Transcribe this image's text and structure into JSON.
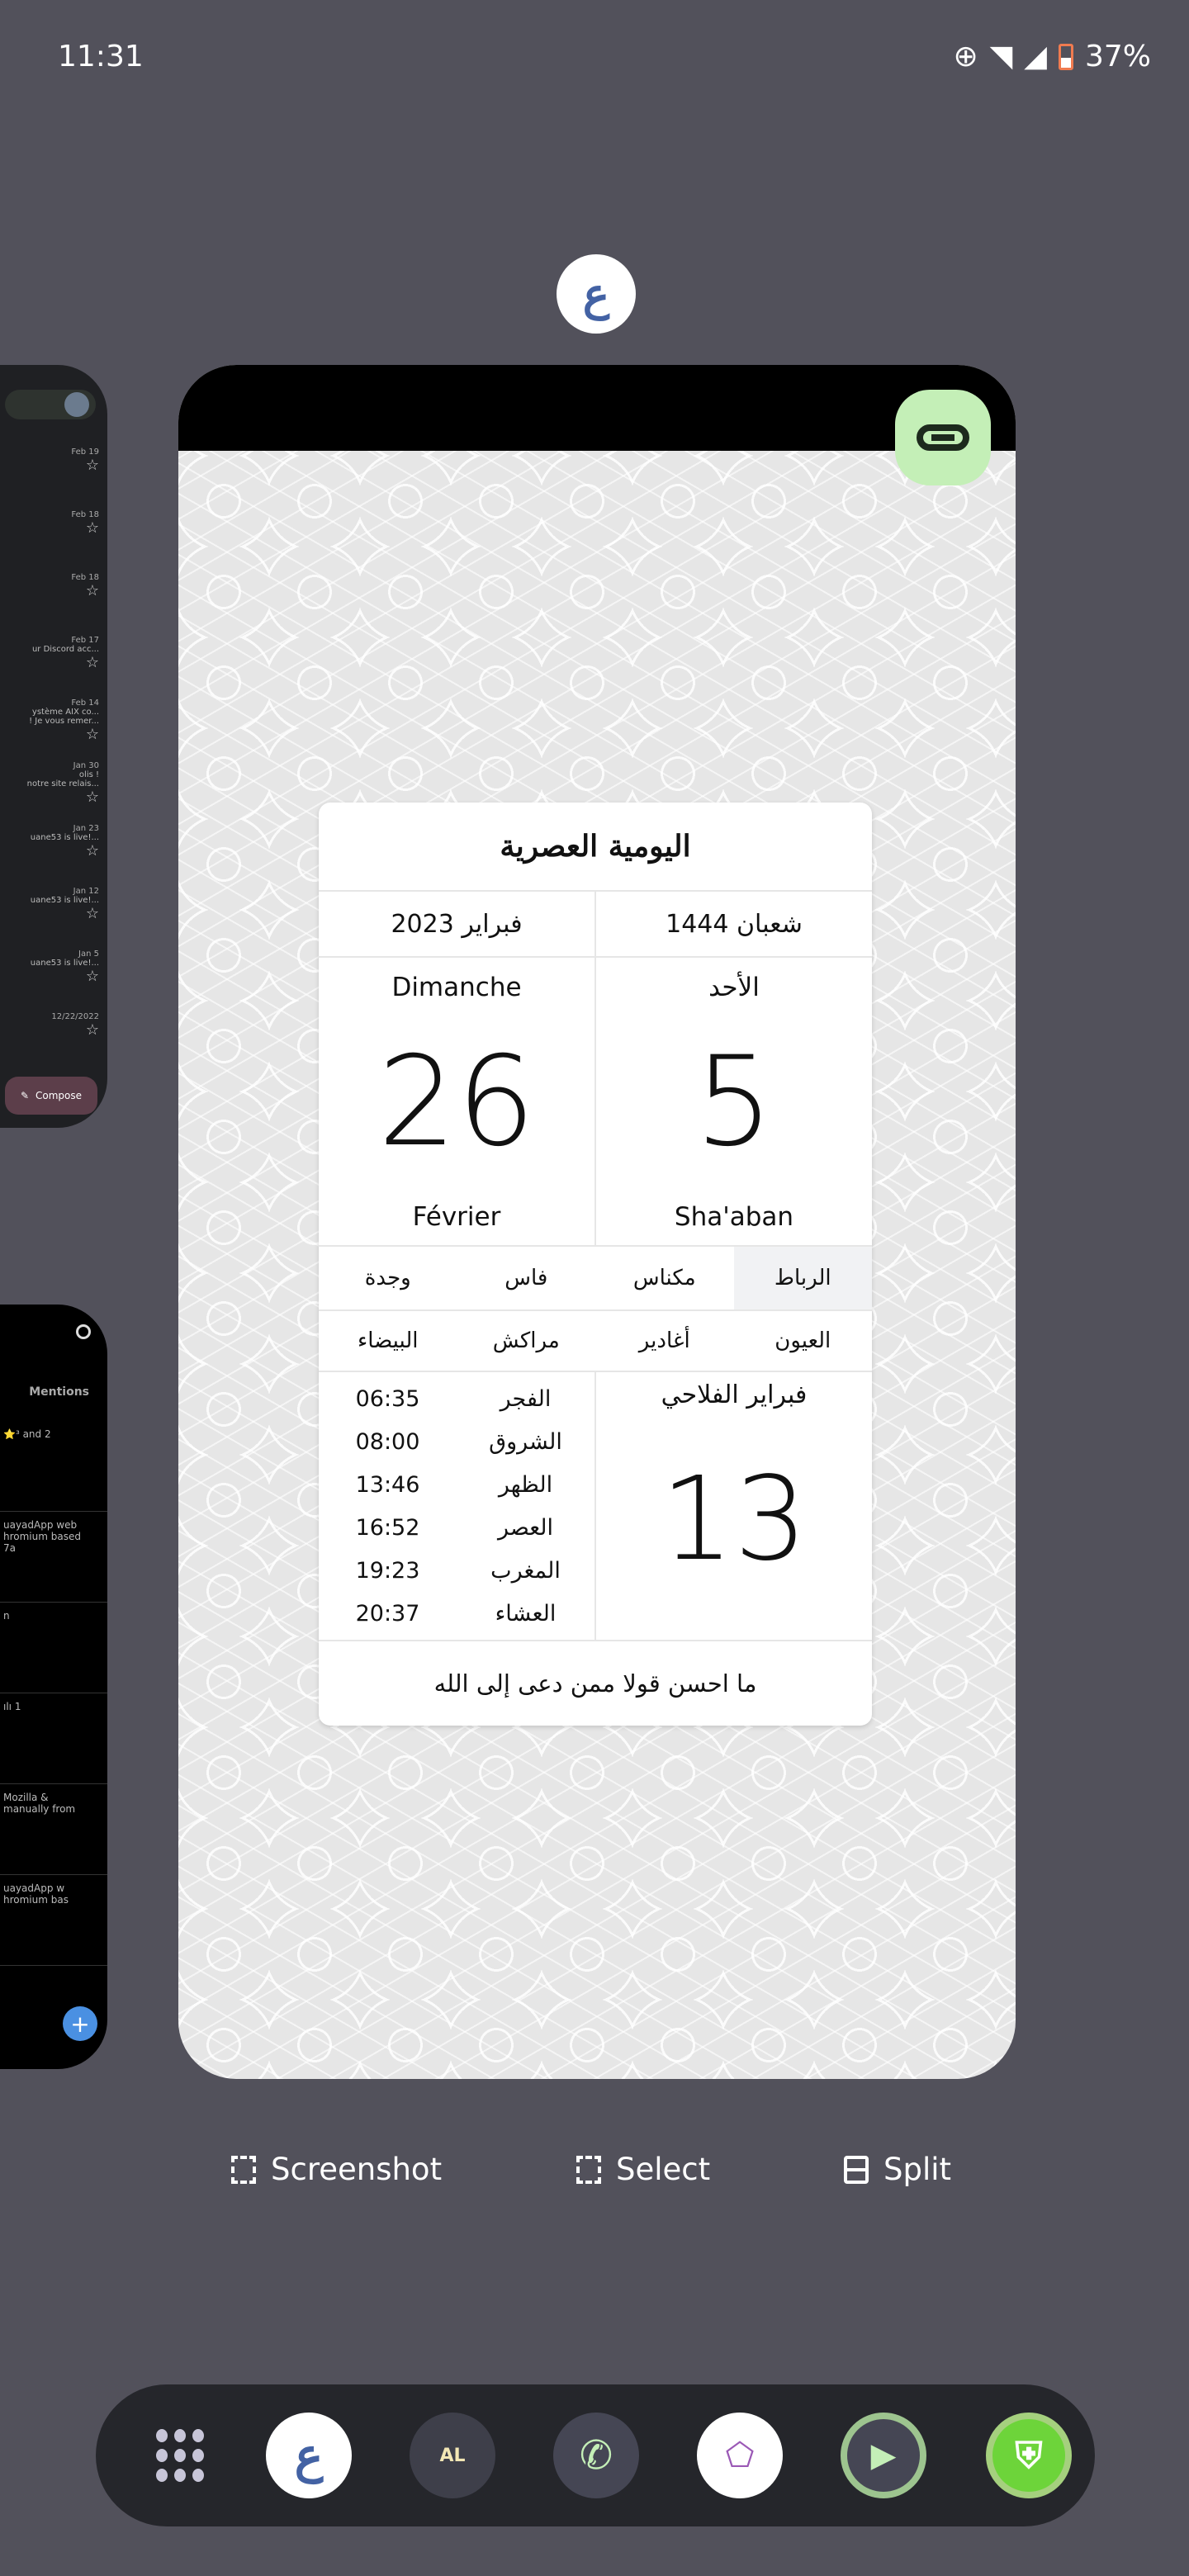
{
  "status_bar": {
    "time": "11:31",
    "battery": "37%",
    "icons": [
      "data-saver-icon",
      "wifi-icon",
      "signal-no-data-icon",
      "battery-charging-icon"
    ]
  },
  "recents": {
    "app_icon": "ع",
    "colors": {
      "background": "#52515b",
      "link_button": "#c4efb7",
      "app_blue": "#4362a4"
    },
    "widget": {
      "title": "اليومية العصرية",
      "gregorian_month": "فبراير 2023",
      "hijri_month": "شعبان 1444",
      "gregorian": {
        "weekday": "Dimanche",
        "day": "26",
        "month": "Février"
      },
      "hijri": {
        "weekday": "الأحد",
        "day": "5",
        "month": "Sha'aban"
      },
      "cities_row1": [
        "الرباط",
        "مكناس",
        "فاس",
        "وجدة"
      ],
      "cities_row2": [
        "العيون",
        "أغادير",
        "مراكش",
        "البيضاء"
      ],
      "selected_city": "الرباط",
      "prayers": [
        {
          "name": "الفجر",
          "time": "06:35"
        },
        {
          "name": "الشروق",
          "time": "08:00"
        },
        {
          "name": "الظهر",
          "time": "13:46"
        },
        {
          "name": "العصر",
          "time": "16:52"
        },
        {
          "name": "المغرب",
          "time": "19:23"
        },
        {
          "name": "العشاء",
          "time": "20:37"
        }
      ],
      "fellahi": {
        "label": "فبراير الفلاحي",
        "day": "13"
      },
      "footer": "ما احسن قولا ممن دعى إلى الله"
    },
    "gmail_card": {
      "mails": [
        {
          "date": "Feb 19",
          "snippet": ""
        },
        {
          "date": "Feb 18",
          "snippet": ""
        },
        {
          "date": "Feb 18",
          "snippet": ""
        },
        {
          "date": "Feb 17",
          "snippet": "ur Discord acc..."
        },
        {
          "date": "Feb 14",
          "snippet": "ystème AIX co...\n! Je vous remer..."
        },
        {
          "date": "Jan 30",
          "snippet": "olis !\nnotre site relais..."
        },
        {
          "date": "Jan 23",
          "snippet": "uane53 is live!..."
        },
        {
          "date": "Jan 12",
          "snippet": "uane53 is live!..."
        },
        {
          "date": "Jan 5",
          "snippet": "uane53 is live!..."
        },
        {
          "date": "12/22/2022",
          "snippet": ""
        }
      ],
      "compose": "Compose"
    },
    "social_card": {
      "tab": "Mentions",
      "snippets": [
        "⭐³ and 2",
        "uayadApp web\nhromium based\n7a",
        "n",
        "ılı 1",
        "Mozilla &\nmanually from",
        "uayadApp w\nhromium bas"
      ]
    }
  },
  "actions": {
    "screenshot": "Screenshot",
    "select": "Select",
    "split": "Split"
  },
  "dock": {
    "apps": [
      "app-drawer",
      "alyawmiya-calendar",
      "folder",
      "phone",
      "5sim",
      "video-player",
      "battery-guard"
    ],
    "folder_label": "AL"
  }
}
